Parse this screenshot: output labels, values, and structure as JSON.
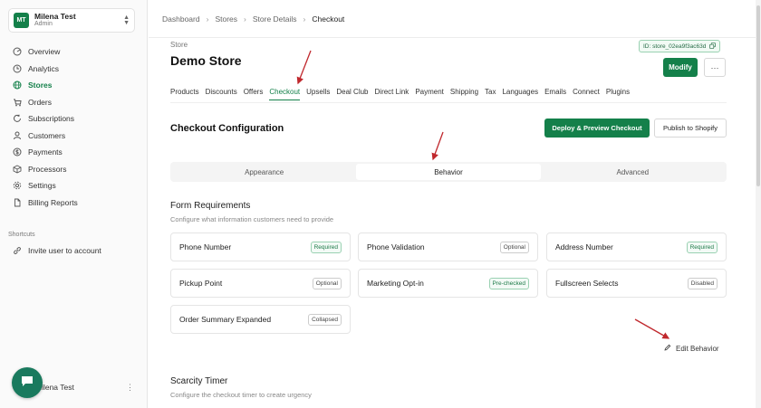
{
  "account": {
    "initials": "MT",
    "name": "Milena Test",
    "role": "Admin"
  },
  "nav": [
    {
      "label": "Overview",
      "icon": "overview-icon"
    },
    {
      "label": "Analytics",
      "icon": "clock-icon"
    },
    {
      "label": "Stores",
      "icon": "globe-icon"
    },
    {
      "label": "Orders",
      "icon": "cart-icon"
    },
    {
      "label": "Subscriptions",
      "icon": "refresh-icon"
    },
    {
      "label": "Customers",
      "icon": "users-icon"
    },
    {
      "label": "Payments",
      "icon": "dollar-icon"
    },
    {
      "label": "Processors",
      "icon": "box-icon"
    },
    {
      "label": "Settings",
      "icon": "gear-icon"
    },
    {
      "label": "Billing Reports",
      "icon": "file-icon"
    }
  ],
  "active_nav": "Stores",
  "shortcuts": {
    "label": "Shortcuts",
    "item": "Invite user to account"
  },
  "footer_user": {
    "name": "Milena Test"
  },
  "breadcrumb": [
    "Dashboard",
    "Stores",
    "Store Details",
    "Checkout"
  ],
  "store": {
    "label": "Store",
    "title": "Demo Store",
    "id_text": "ID: store_02ea9f3ac63d"
  },
  "buttons": {
    "modify": "Modify",
    "more": "···",
    "deploy": "Deploy & Preview Checkout",
    "publish": "Publish to Shopify",
    "edit_behavior": "Edit Behavior"
  },
  "tabs": [
    "Products",
    "Discounts",
    "Offers",
    "Checkout",
    "Upsells",
    "Deal Club",
    "Direct Link",
    "Payment",
    "Shipping",
    "Tax",
    "Languages",
    "Emails",
    "Connect",
    "Plugins"
  ],
  "active_tab": "Checkout",
  "checkout_config": {
    "title": "Checkout Configuration"
  },
  "segments": [
    "Appearance",
    "Behavior",
    "Advanced"
  ],
  "active_segment": "Behavior",
  "form_requirements": {
    "title": "Form Requirements",
    "subtitle": "Configure what information customers need to provide",
    "items": [
      {
        "label": "Phone Number",
        "badge": "Required"
      },
      {
        "label": "Phone Validation",
        "badge": "Optional"
      },
      {
        "label": "Address Number",
        "badge": "Required"
      },
      {
        "label": "Pickup Point",
        "badge": "Optional"
      },
      {
        "label": "Marketing Opt-in",
        "badge": "Pre-checked"
      },
      {
        "label": "Fullscreen Selects",
        "badge": "Disabled"
      },
      {
        "label": "Order Summary Expanded",
        "badge": "Collapsed"
      }
    ]
  },
  "scarcity": {
    "title": "Scarcity Timer",
    "subtitle": "Configure the checkout timer to create urgency"
  },
  "colors": {
    "accent": "#14804a",
    "annotation_arrow": "#c0282d"
  }
}
